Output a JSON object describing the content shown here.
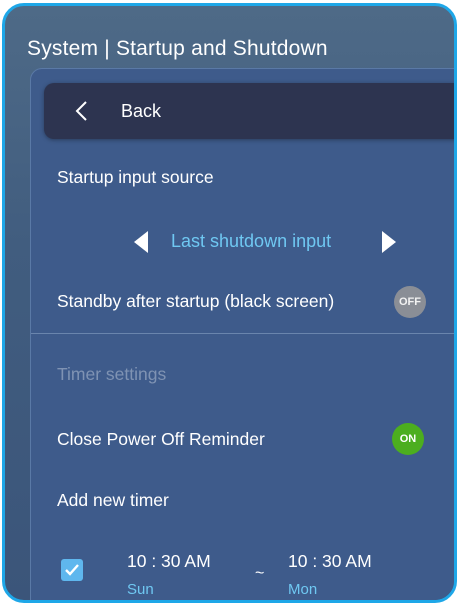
{
  "header": {
    "title": "System | Startup and Shutdown"
  },
  "back": {
    "label": "Back"
  },
  "startup_input": {
    "label": "Startup input source",
    "value": "Last shutdown input"
  },
  "standby": {
    "label": "Standby after startup (black screen)",
    "toggle": "OFF"
  },
  "timer_section": {
    "label": "Timer settings"
  },
  "reminder": {
    "label": "Close Power Off Reminder",
    "toggle": "ON"
  },
  "add_timer": {
    "label": "Add new timer"
  },
  "timer_entry": {
    "checked": true,
    "start_time": "10 : 30 AM",
    "start_day": "Sun",
    "separator": "~",
    "end_time": "10 : 30 AM",
    "end_day": "Mon"
  },
  "colors": {
    "frame_border": "#1ea7e8",
    "accent_text": "#6fc8f2",
    "toggle_on": "#4cae1f",
    "toggle_off": "#8a8e96"
  }
}
